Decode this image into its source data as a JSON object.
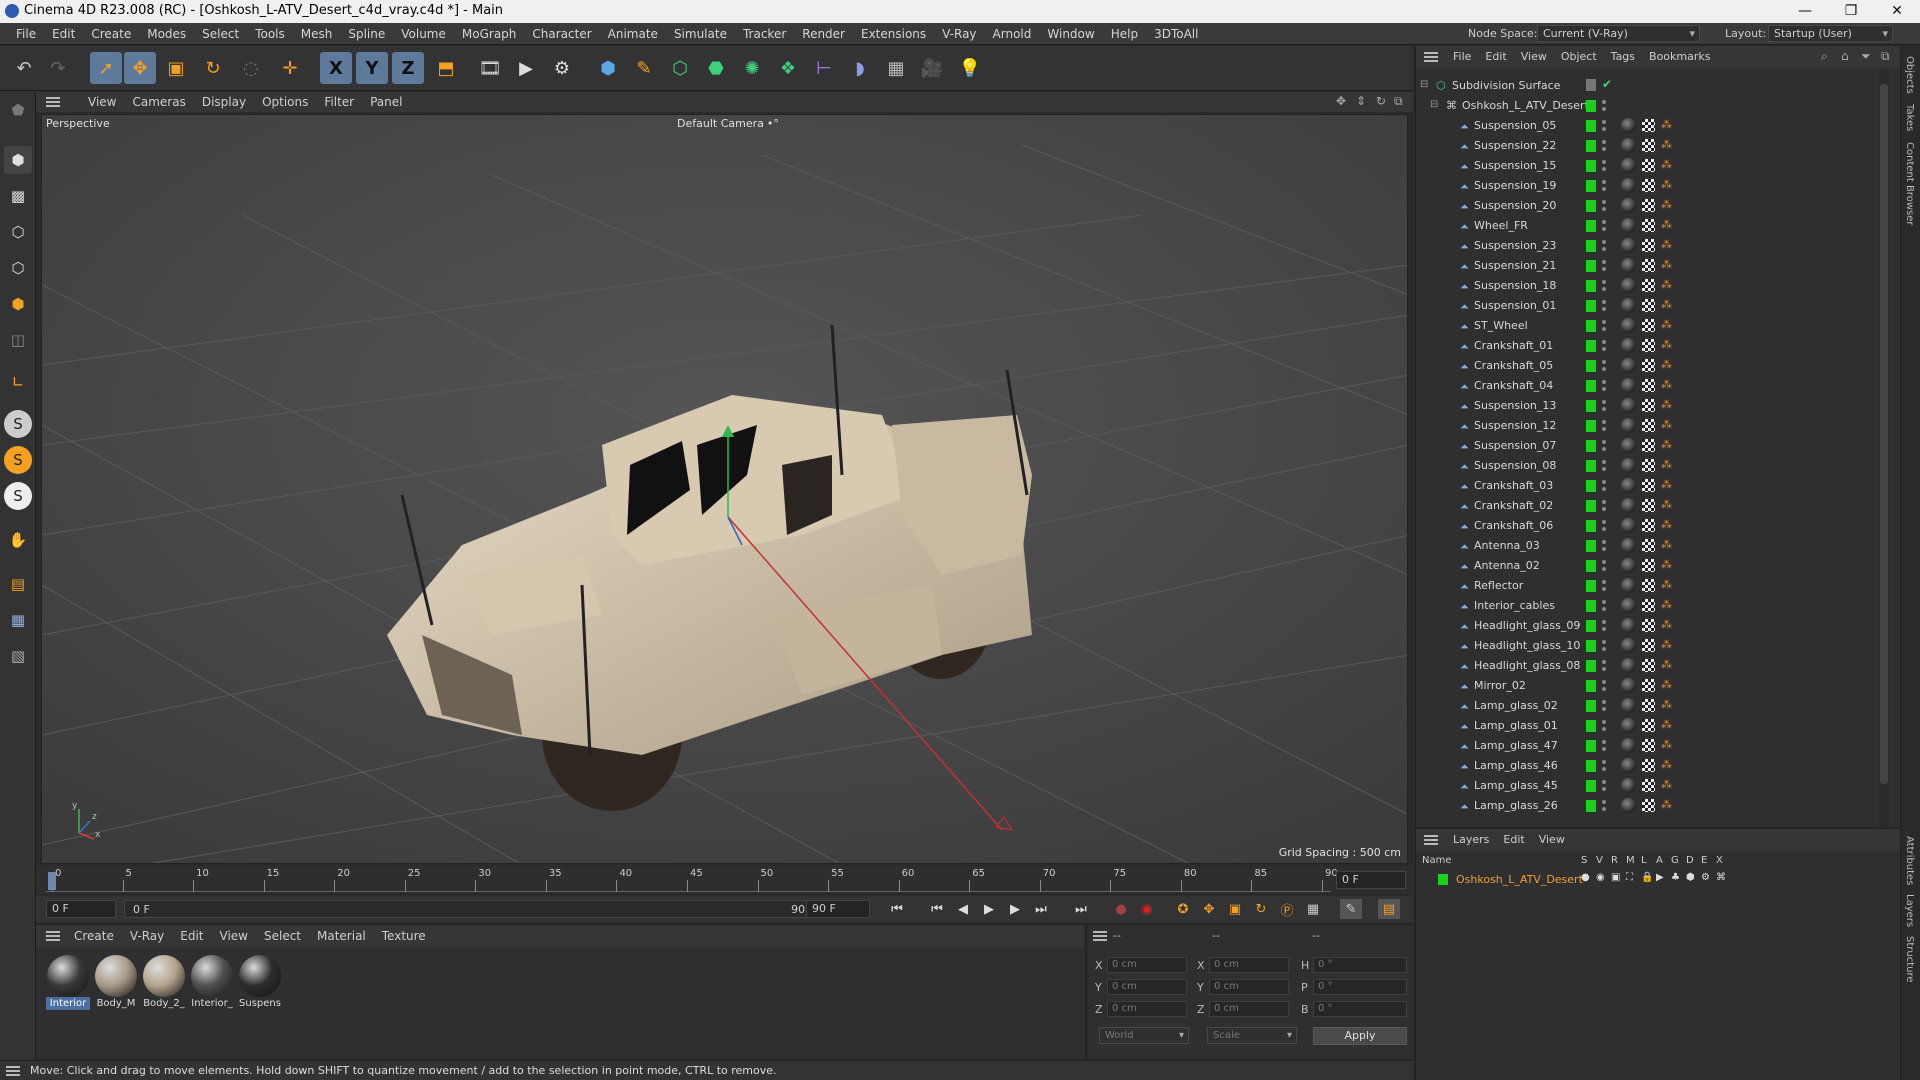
{
  "window": {
    "title": "Cinema 4D R23.008 (RC) - [Oshkosh_L-ATV_Desert_c4d_vray.c4d *] - Main",
    "minimize": "—",
    "maximize": "❐",
    "close": "✕"
  },
  "menubar": {
    "items": [
      "File",
      "Edit",
      "Create",
      "Modes",
      "Select",
      "Tools",
      "Mesh",
      "Spline",
      "Volume",
      "MoGraph",
      "Character",
      "Animate",
      "Simulate",
      "Tracker",
      "Render",
      "Extensions",
      "V-Ray",
      "Arnold",
      "Window",
      "Help",
      "3DToAll"
    ],
    "node_space_label": "Node Space:",
    "node_space_value": "Current (V-Ray)",
    "layout_label": "Layout:",
    "layout_value": "Startup (User)"
  },
  "toolbar_icons": [
    "undo-icon",
    "redo-icon",
    "select-icon",
    "move-icon",
    "scale-icon",
    "rotate-icon",
    "recent-icon",
    "add-icon",
    "x-axis-icon",
    "y-axis-icon",
    "z-axis-icon",
    "coordinate-system-icon",
    "render-region-icon",
    "render-view-icon",
    "render-settings-icon",
    "cube-icon",
    "pen-icon",
    "subdivision-icon",
    "extrude-icon",
    "cloner-icon",
    "voronoi-icon",
    "measure-icon",
    "deformer-icon",
    "floor-icon",
    "camera-icon",
    "light-icon"
  ],
  "axis_labels": {
    "x": "X",
    "y": "Y",
    "z": "Z"
  },
  "viewport": {
    "menu": [
      "View",
      "Cameras",
      "Display",
      "Options",
      "Filter",
      "Panel"
    ],
    "name": "Perspective",
    "camera": "Default Camera",
    "camera_suffix": "•°",
    "grid_spacing": "Grid Spacing : 500 cm",
    "axis": {
      "x": "x",
      "y": "y",
      "z": "z"
    }
  },
  "timeline": {
    "ticks": [
      "0",
      "5",
      "10",
      "15",
      "20",
      "25",
      "30",
      "35",
      "40",
      "45",
      "50",
      "55",
      "60",
      "65",
      "70",
      "75",
      "80",
      "85",
      "90"
    ],
    "current_frame": "0 F",
    "start_field": "0 F",
    "range_start": "0 F",
    "range_end": "90 F",
    "end_field": "90 F"
  },
  "material_manager": {
    "menu": [
      "Create",
      "V-Ray",
      "Edit",
      "View",
      "Select",
      "Material",
      "Texture"
    ],
    "materials": [
      {
        "name": "Interior",
        "color": "#3a3a3a",
        "selected": true
      },
      {
        "name": "Body_M",
        "color": "#a89a86",
        "selected": false
      },
      {
        "name": "Body_2_",
        "color": "#b4a48c",
        "selected": false
      },
      {
        "name": "Interior_",
        "color": "#505050",
        "selected": false
      },
      {
        "name": "Suspens",
        "color": "#2e2e2e",
        "selected": false
      }
    ]
  },
  "coordinates": {
    "headers": [
      "--",
      "--",
      "--"
    ],
    "rows": [
      {
        "a": "X",
        "av": "0 cm",
        "b": "X",
        "bv": "0 cm",
        "c": "H",
        "cv": "0 °"
      },
      {
        "a": "Y",
        "av": "0 cm",
        "b": "Y",
        "bv": "0 cm",
        "c": "P",
        "cv": "0 °"
      },
      {
        "a": "Z",
        "av": "0 cm",
        "b": "Z",
        "bv": "0 cm",
        "c": "B",
        "cv": "0 °"
      }
    ],
    "mode1": "World",
    "mode2": "Scale",
    "apply": "Apply"
  },
  "status": "Move: Click and drag to move elements. Hold down SHIFT to quantize movement / add to the selection in point mode, CTRL to remove.",
  "object_manager": {
    "menu": [
      "File",
      "Edit",
      "View",
      "Object",
      "Tags",
      "Bookmarks"
    ],
    "root": "Subdivision Surface",
    "group": "Oshkosh_L_ATV_Desert",
    "objects": [
      "Suspension_05",
      "Suspension_22",
      "Suspension_15",
      "Suspension_19",
      "Suspension_20",
      "Wheel_FR",
      "Suspension_23",
      "Suspension_21",
      "Suspension_18",
      "Suspension_01",
      "ST_Wheel",
      "Crankshaft_01",
      "Crankshaft_05",
      "Crankshaft_04",
      "Suspension_13",
      "Suspension_12",
      "Suspension_07",
      "Suspension_08",
      "Crankshaft_03",
      "Crankshaft_02",
      "Crankshaft_06",
      "Antenna_03",
      "Antenna_02",
      "Reflector",
      "Interior_cables",
      "Headlight_glass_09",
      "Headlight_glass_10",
      "Headlight_glass_08",
      "Mirror_02",
      "Lamp_glass_02",
      "Lamp_glass_01",
      "Lamp_glass_47",
      "Lamp_glass_46",
      "Lamp_glass_45",
      "Lamp_glass_26"
    ]
  },
  "layers": {
    "menu": [
      "Layers",
      "Edit",
      "View"
    ],
    "columns": [
      "Name",
      "S",
      "V",
      "R",
      "M",
      "L",
      "A",
      "G",
      "D",
      "E",
      "X"
    ],
    "items": [
      {
        "name": "Oshkosh_L_ATV_Desert",
        "color": "#19d219"
      }
    ]
  },
  "side_tabs": [
    "Objects",
    "Takes",
    "Content Browser",
    "Attributes",
    "Layers",
    "Structure"
  ],
  "colors": {
    "accent": "#5e7a9a",
    "visible_green": "#19d219",
    "layer_orange": "#f0a030"
  }
}
